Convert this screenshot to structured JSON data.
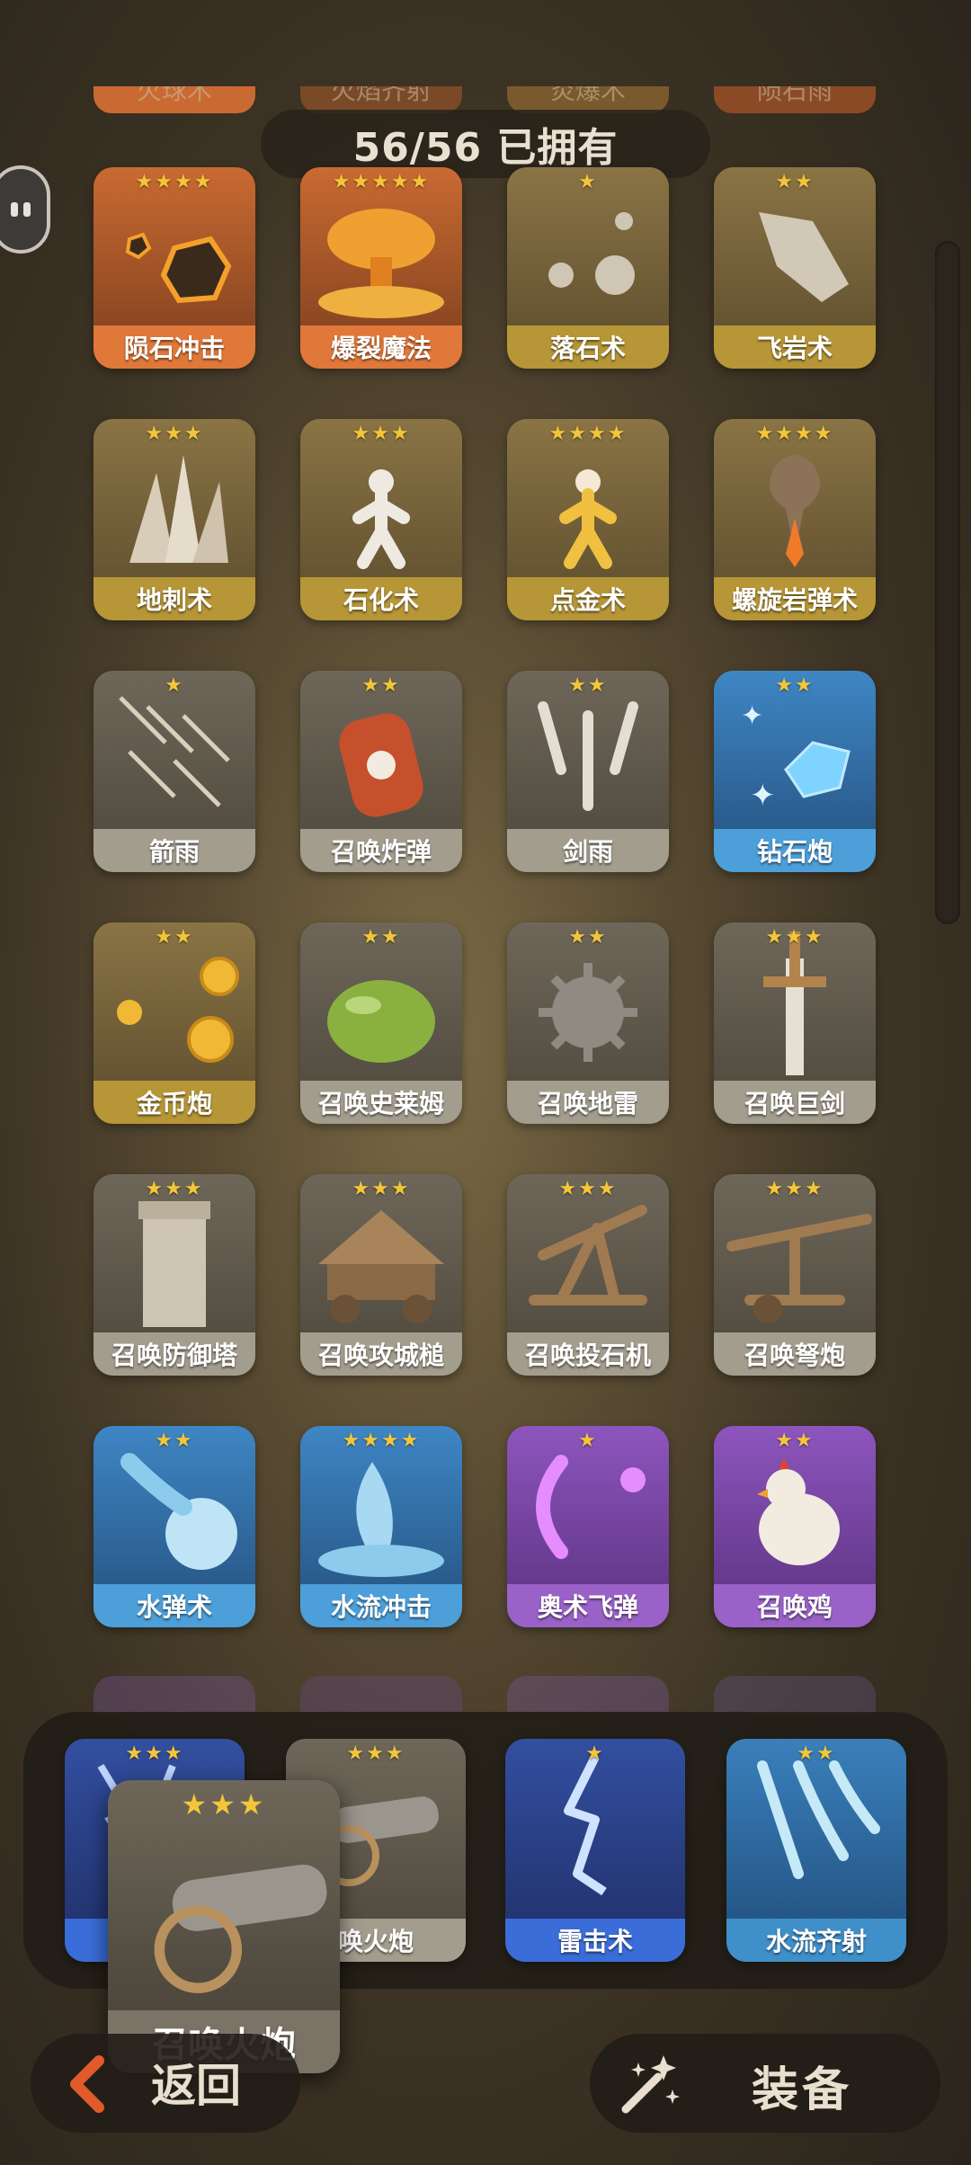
{
  "header": {
    "owned_text": "56/56 已拥有"
  },
  "top_partial_labels": [
    "火球术",
    "火焰齐射",
    "炎爆术",
    "陨石雨"
  ],
  "colors": {
    "orange": "#e0783a",
    "gold": "#b69636",
    "grey": "#a39d8e",
    "blue": "#4d9fd9",
    "purple": "#9a62c8",
    "dark_blue": "#3a6dd8",
    "teal": "#3f8fc9"
  },
  "grid": [
    {
      "label": "陨石冲击",
      "stars": "★★★★",
      "theme": "orange",
      "icon": "meteor-icon"
    },
    {
      "label": "爆裂魔法",
      "stars": "★★★★★",
      "theme": "orange",
      "icon": "explosion-icon"
    },
    {
      "label": "落石术",
      "stars": "★",
      "theme": "gold",
      "icon": "falling-rock-icon"
    },
    {
      "label": "飞岩术",
      "stars": "★★",
      "theme": "gold",
      "icon": "flying-rock-icon"
    },
    {
      "label": "地刺术",
      "stars": "★★★",
      "theme": "gold",
      "icon": "earth-spike-icon"
    },
    {
      "label": "石化术",
      "stars": "★★★",
      "theme": "gold",
      "icon": "petrify-icon"
    },
    {
      "label": "点金术",
      "stars": "★★★★",
      "theme": "gold",
      "icon": "midas-icon"
    },
    {
      "label": "螺旋岩弹术",
      "stars": "★★★★",
      "theme": "gold",
      "icon": "spiral-rock-icon"
    },
    {
      "label": "箭雨",
      "stars": "★",
      "theme": "grey",
      "icon": "arrow-rain-icon"
    },
    {
      "label": "召唤炸弹",
      "stars": "★★",
      "theme": "grey",
      "icon": "bomb-barrel-icon"
    },
    {
      "label": "剑雨",
      "stars": "★★",
      "theme": "grey",
      "icon": "sword-rain-icon"
    },
    {
      "label": "钻石炮",
      "stars": "★★",
      "theme": "blue",
      "icon": "diamond-icon"
    },
    {
      "label": "金币炮",
      "stars": "★★",
      "theme": "gold",
      "icon": "gold-coin-icon"
    },
    {
      "label": "召唤史莱姆",
      "stars": "★★",
      "theme": "grey",
      "icon": "slime-icon"
    },
    {
      "label": "召唤地雷",
      "stars": "★★",
      "theme": "grey",
      "icon": "landmine-icon"
    },
    {
      "label": "召唤巨剑",
      "stars": "★★★",
      "theme": "grey",
      "icon": "giant-sword-icon"
    },
    {
      "label": "召唤防御塔",
      "stars": "★★★",
      "theme": "grey",
      "icon": "tower-icon"
    },
    {
      "label": "召唤攻城槌",
      "stars": "★★★",
      "theme": "grey",
      "icon": "battering-ram-icon"
    },
    {
      "label": "召唤投石机",
      "stars": "★★★",
      "theme": "grey",
      "icon": "catapult-icon"
    },
    {
      "label": "召唤弩炮",
      "stars": "★★★",
      "theme": "grey",
      "icon": "ballista-icon"
    },
    {
      "label": "水弹术",
      "stars": "★★",
      "theme": "blue",
      "icon": "water-ball-icon"
    },
    {
      "label": "水流冲击",
      "stars": "★★★★",
      "theme": "blue",
      "icon": "water-burst-icon"
    },
    {
      "label": "奥术飞弹",
      "stars": "★",
      "theme": "purple",
      "icon": "arcane-missile-icon"
    },
    {
      "label": "召唤鸡",
      "stars": "★★",
      "theme": "purple",
      "icon": "chicken-icon"
    }
  ],
  "tray": [
    {
      "label": "闪电链",
      "visible_label": "闪",
      "stars": "★★★",
      "theme": "dark_blue",
      "icon": "chain-lightning-icon"
    },
    {
      "label": "召唤火炮",
      "visible_label": "唤火炮",
      "stars": "★★★",
      "theme": "grey",
      "icon": "cannon-icon"
    },
    {
      "label": "雷击术",
      "visible_label": "雷击术",
      "stars": "★",
      "theme": "dark_blue",
      "icon": "lightning-icon"
    },
    {
      "label": "水流齐射",
      "visible_label": "水流齐射",
      "stars": "★★",
      "theme": "teal",
      "icon": "water-volley-icon"
    }
  ],
  "dragging": {
    "label": "召唤火炮",
    "stars": "★★★",
    "icon": "cannon-icon"
  },
  "footer": {
    "back_label": "返回",
    "equip_label": "装备"
  }
}
